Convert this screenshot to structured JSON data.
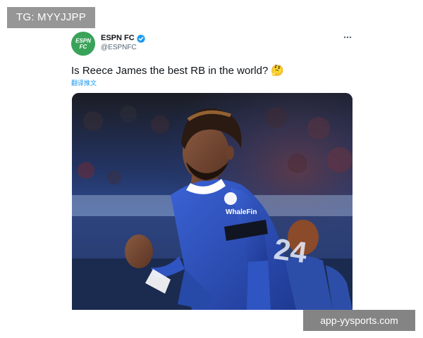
{
  "watermark_top": "TG: MYYJJPP",
  "watermark_bottom": "app-yysports.com",
  "tweet": {
    "display_name": "ESPN FC",
    "handle": "@ESPNFC",
    "verified": true,
    "avatar_text": "ESPN FC",
    "text": "Is Reece James the best RB in the world?",
    "emoji": "🤔",
    "translate_label": "翻译推文",
    "more_icon": "more-horizontal-icon"
  },
  "photo": {
    "sponsor_text": "WhaleFin",
    "shirt_number": "24"
  },
  "colors": {
    "avatar_green": "#3aa35a",
    "link_blue": "#1d9bf0",
    "verified_blue": "#1d9bf0",
    "kit_blue": "#2d4fb5"
  }
}
